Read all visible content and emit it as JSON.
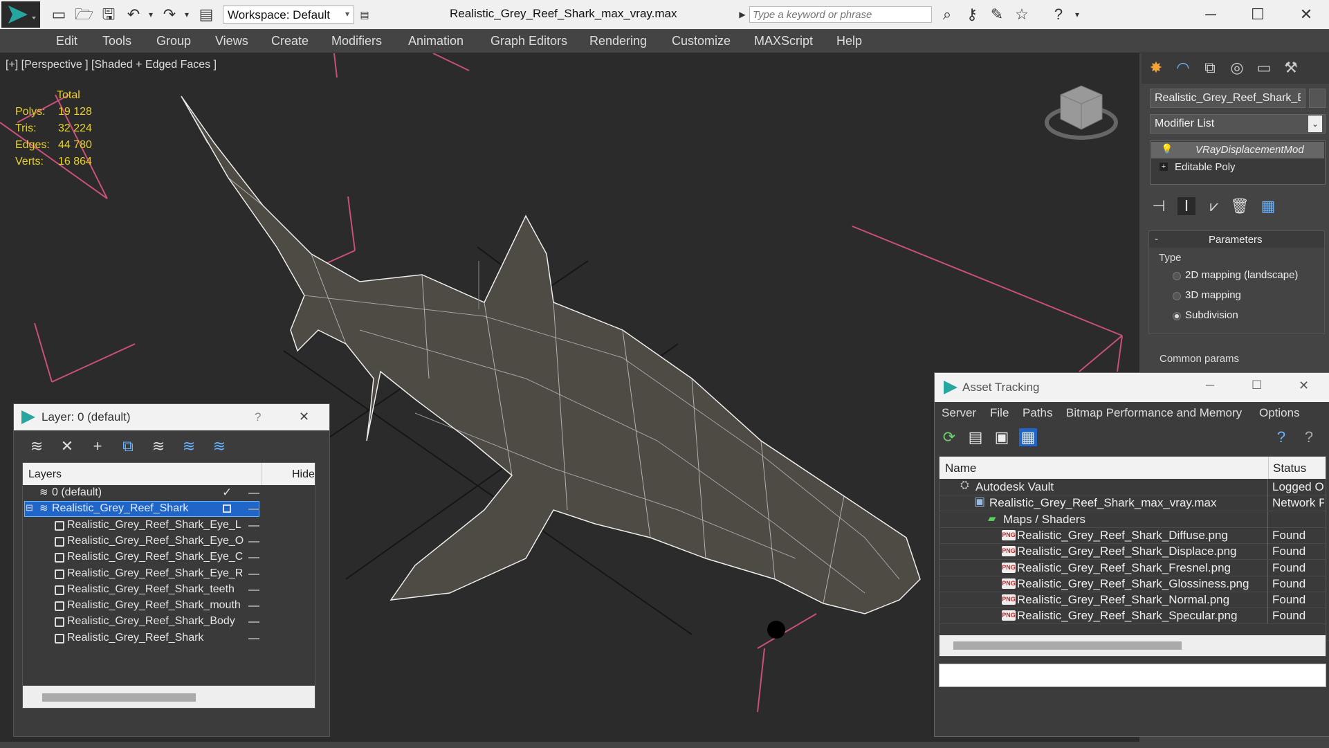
{
  "title_bar": {
    "window_title": "Realistic_Grey_Reef_Shark_max_vray.max",
    "workspace_label": "Workspace: Default",
    "search_placeholder": "Type a keyword or phrase"
  },
  "menu": {
    "items": [
      "Edit",
      "Tools",
      "Group",
      "Views",
      "Create",
      "Modifiers",
      "Animation",
      "Graph Editors",
      "Rendering",
      "Customize",
      "MAXScript",
      "Help"
    ]
  },
  "viewport": {
    "label": "[+] [Perspective ] [Shaded + Edged Faces ]",
    "stats": {
      "header": "Total",
      "rows": [
        {
          "label": "Polys:",
          "value": "19 128"
        },
        {
          "label": "Tris:",
          "value": "32 224"
        },
        {
          "label": "Edges:",
          "value": "44 780"
        },
        {
          "label": "Verts:",
          "value": "16 864"
        }
      ]
    }
  },
  "command_panel": {
    "object_name": "Realistic_Grey_Reef_Shark_Body",
    "modifier_list_label": "Modifier List",
    "stack": [
      {
        "label": "VRayDisplacementMod"
      },
      {
        "label": "Editable Poly"
      }
    ],
    "rollout_title": "Parameters",
    "rollout_collapse": "-",
    "type_group_label": "Type",
    "type_options": [
      {
        "label": "2D mapping (landscape)",
        "selected": false
      },
      {
        "label": "3D mapping",
        "selected": false
      },
      {
        "label": "Subdivision",
        "selected": true
      }
    ],
    "common_params_label": "Common params"
  },
  "layer_window": {
    "title": "Layer: 0 (default)",
    "help": "?",
    "close": "✕",
    "col_layers": "Layers",
    "col_hide": "Hide",
    "rows": [
      {
        "label": "0 (default)",
        "indent": 1,
        "kind": "layer",
        "selected": false,
        "checked": true
      },
      {
        "label": "Realistic_Grey_Reef_Shark",
        "indent": 1,
        "kind": "layer",
        "selected": true,
        "checked": false
      },
      {
        "label": "Realistic_Grey_Reef_Shark_Eye_L",
        "indent": 2,
        "kind": "object"
      },
      {
        "label": "Realistic_Grey_Reef_Shark_Eye_O",
        "indent": 2,
        "kind": "object"
      },
      {
        "label": "Realistic_Grey_Reef_Shark_Eye_C",
        "indent": 2,
        "kind": "object"
      },
      {
        "label": "Realistic_Grey_Reef_Shark_Eye_R",
        "indent": 2,
        "kind": "object"
      },
      {
        "label": "Realistic_Grey_Reef_Shark_teeth",
        "indent": 2,
        "kind": "object"
      },
      {
        "label": "Realistic_Grey_Reef_Shark_mouth",
        "indent": 2,
        "kind": "object"
      },
      {
        "label": "Realistic_Grey_Reef_Shark_Body",
        "indent": 2,
        "kind": "object"
      },
      {
        "label": "Realistic_Grey_Reef_Shark",
        "indent": 2,
        "kind": "object"
      }
    ]
  },
  "asset_window": {
    "title": "Asset Tracking",
    "menu": [
      "Server",
      "File",
      "Paths",
      "Bitmap Performance and Memory",
      "Options"
    ],
    "col_name": "Name",
    "col_status": "Status",
    "rows": [
      {
        "name": "Autodesk Vault",
        "status": "Logged Ou",
        "indent": 1,
        "icon": "vault"
      },
      {
        "name": "Realistic_Grey_Reef_Shark_max_vray.max",
        "status": "Network P",
        "indent": 2,
        "icon": "max"
      },
      {
        "name": "Maps / Shaders",
        "status": "",
        "indent": 3,
        "icon": "maps"
      },
      {
        "name": "Realistic_Grey_Reef_Shark_Diffuse.png",
        "status": "Found",
        "indent": 4,
        "icon": "png"
      },
      {
        "name": "Realistic_Grey_Reef_Shark_Displace.png",
        "status": "Found",
        "indent": 4,
        "icon": "png"
      },
      {
        "name": "Realistic_Grey_Reef_Shark_Fresnel.png",
        "status": "Found",
        "indent": 4,
        "icon": "png"
      },
      {
        "name": "Realistic_Grey_Reef_Shark_Glossiness.png",
        "status": "Found",
        "indent": 4,
        "icon": "png"
      },
      {
        "name": "Realistic_Grey_Reef_Shark_Normal.png",
        "status": "Found",
        "indent": 4,
        "icon": "png"
      },
      {
        "name": "Realistic_Grey_Reef_Shark_Specular.png",
        "status": "Found",
        "indent": 4,
        "icon": "png"
      }
    ],
    "png_badge": "PNG"
  },
  "colors": {
    "viewport_bg": "#2b2b2b",
    "stats_text": "#e8d22a",
    "selection_blue": "#1f66c8",
    "wire_red": "#c8507a",
    "accent_teal": "#27a6a0"
  }
}
